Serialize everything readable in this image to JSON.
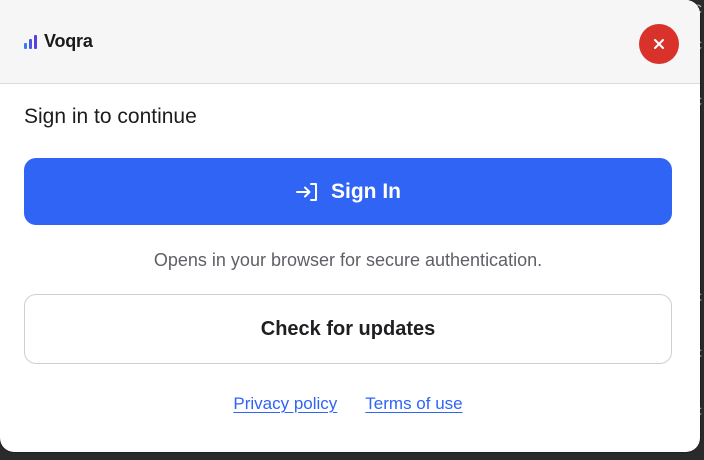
{
  "app": {
    "name": "Voqra",
    "icon": "signal-bars-icon",
    "accent": "#2f64f5",
    "close_color": "#d9322b"
  },
  "header": {
    "close_label": "×"
  },
  "main": {
    "title": "Sign in to continue",
    "signin_label": "Sign In",
    "signin_icon": "sign-in-arrow-icon",
    "hint": "Opens in your browser for secure authentication.",
    "updates_label": "Check for updates"
  },
  "footer": {
    "links": [
      {
        "label": "Privacy policy"
      },
      {
        "label": "Terms of use"
      }
    ]
  }
}
